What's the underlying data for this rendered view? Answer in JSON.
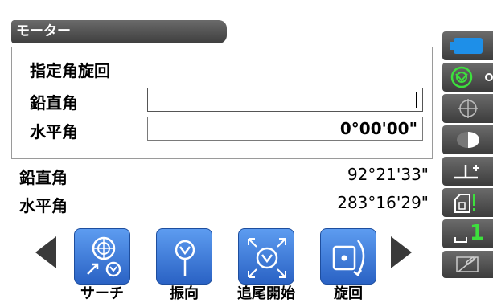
{
  "window": {
    "title": "モーター"
  },
  "panel": {
    "heading": "指定角旋回",
    "vertical_label": "鉛直角",
    "vertical_value": "",
    "horizontal_label": "水平角",
    "horizontal_value": "0°00'00\""
  },
  "measurements": {
    "vertical_label": "鉛直角",
    "vertical_value": "92°21'33\"",
    "horizontal_label": "水平角",
    "horizontal_value": "283°16'29\""
  },
  "softkeys": [
    {
      "label": "サーチ",
      "icon": "search-target-icon"
    },
    {
      "label": "振向",
      "icon": "point-direction-icon"
    },
    {
      "label": "追尾開始",
      "icon": "tracking-start-icon"
    },
    {
      "label": "旋回",
      "icon": "rotate-icon"
    }
  ],
  "side_panel": {
    "icons": [
      "battery-icon",
      "prism-target-icon",
      "crosshair-icon",
      "half-circle-icon",
      "tilt-correction-icon",
      "memory-icon",
      "input-mode-icon",
      "edit-icon"
    ],
    "input_mode_digit": "1"
  },
  "colors": {
    "title_bar": "#4a4a4a",
    "softkey": "#3e7fe0",
    "side_panel": "#4f4f4f",
    "status_green": "#3de03d",
    "battery_blue": "#1e8fe8"
  }
}
